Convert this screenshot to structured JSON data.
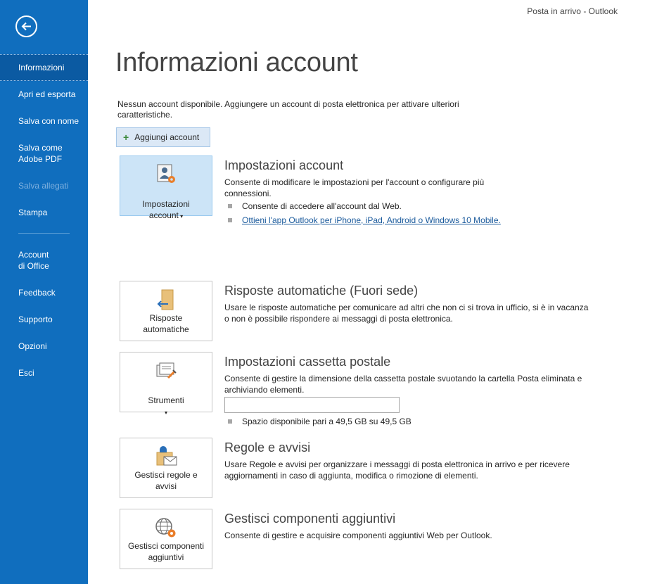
{
  "app": {
    "title": "Posta in arrivo  -  Outlook"
  },
  "sidebar": {
    "items": [
      {
        "label": "Informazioni"
      },
      {
        "label": "Apri ed esporta"
      },
      {
        "label": "Salva con nome"
      },
      {
        "label": "Salva come\nAdobe PDF"
      },
      {
        "label": "Salva allegati"
      },
      {
        "label": "Stampa"
      },
      {
        "label": "Account\ndi Office"
      },
      {
        "label": "Feedback"
      },
      {
        "label": "Supporto"
      },
      {
        "label": "Opzioni"
      },
      {
        "label": "Esci"
      }
    ],
    "active_item": "Informazioni",
    "disabled_item": "Salva allegati",
    "back_icon": "back-arrow-icon"
  },
  "main": {
    "page_title": "Informazioni account",
    "no_account_text": "Nessun account disponibile. Aggiungere un account di posta elettronica per attivare ulteriori caratteristiche.",
    "add_account_label": "Aggiungi account",
    "sections": {
      "account_settings": {
        "tile_label": "Impostazioni\naccount",
        "title": "Impostazioni account",
        "description": "Consente di modificare le impostazioni per l'account o configurare più connessioni.",
        "bullet1": "Consente di accedere all'account dal Web.",
        "link": "Ottieni l'app Outlook per iPhone, iPad, Android o Windows 10 Mobile."
      },
      "auto_replies": {
        "tile_label": "Risposte\nautomatiche",
        "title": "Risposte automatiche (Fuori sede)",
        "description": "Usare le risposte automatiche per comunicare ad altri che non ci si trova in ufficio, si è in vacanza o non è possibile rispondere ai messaggi di posta elettronica."
      },
      "mailbox": {
        "tile_label": "Strumenti",
        "title": "Impostazioni cassetta postale",
        "description": "Consente di gestire la dimensione della cassetta postale svuotando la cartella Posta eliminata e archiviando elementi.",
        "quota_text": "Spazio disponibile pari a 49,5 GB su 49,5 GB",
        "quota_used_fraction": 0
      },
      "rules": {
        "tile_label": "Gestisci regole e\navvisi",
        "title": "Regole e avvisi",
        "description": "Usare Regole e avvisi per organizzare i messaggi di posta elettronica in arrivo e per ricevere aggiornamenti in caso di aggiunta, modifica o rimozione di elementi."
      },
      "addins": {
        "tile_label": "Gestisci componenti\naggiuntivi",
        "title": "Gestisci componenti aggiuntivi",
        "description": "Consente di gestire e acquisire componenti aggiuntivi Web per Outlook."
      }
    }
  },
  "colors": {
    "sidebar_bg": "#106ebe",
    "sidebar_active": "#0b5aa2",
    "selected_tile": "#cce4f7",
    "accent_orange": "#e97e2b"
  }
}
